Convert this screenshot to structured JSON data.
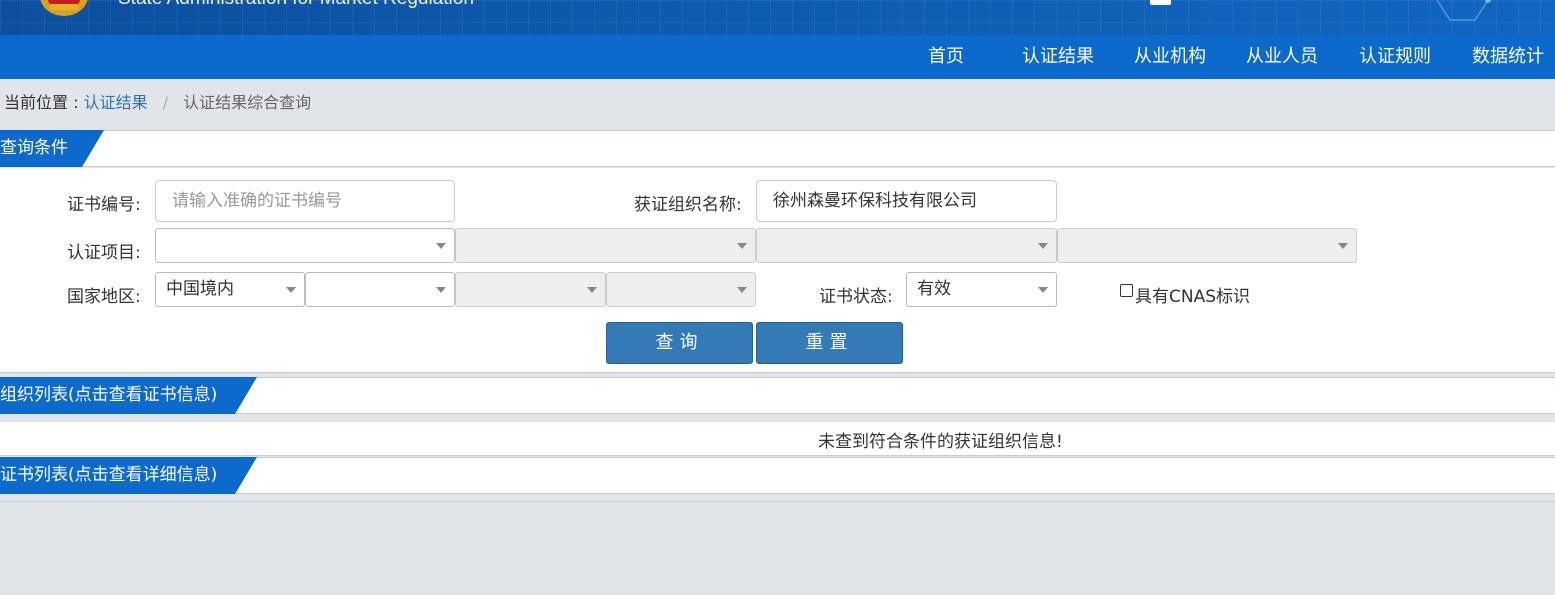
{
  "header": {
    "site_name_en": "State Administration  for  Market Regulation"
  },
  "nav": {
    "items": [
      "首页",
      "认证结果",
      "从业机构",
      "从业人员",
      "认证规则",
      "数据统计"
    ]
  },
  "breadcrumb": {
    "prefix": "当前位置 :",
    "link": "认证结果",
    "separator": "/",
    "current": "认证结果综合查询"
  },
  "query": {
    "section_title": "查询条件",
    "cert_no_label": "证书编号:",
    "cert_no_placeholder": "请输入准确的证书编号",
    "org_name_label": "获证组织名称:",
    "org_name_value": "徐州森曼环保科技有限公司",
    "project_label": "认证项目:",
    "country_label": "国家地区:",
    "country_value": "中国境内",
    "status_label": "证书状态:",
    "status_value": "有效",
    "cnas_label": "具有CNAS标识",
    "search_button": "查询",
    "reset_button": "重置"
  },
  "org_list": {
    "section_title": "组织列表(点击查看证书信息)",
    "empty_message": "未查到符合条件的获证组织信息!"
  },
  "cert_list": {
    "section_title": "证书列表(点击查看详细信息)"
  },
  "colors": {
    "brand_blue": "#0b6acb",
    "button_blue": "#347ab7",
    "link_blue": "#2a74b8"
  }
}
